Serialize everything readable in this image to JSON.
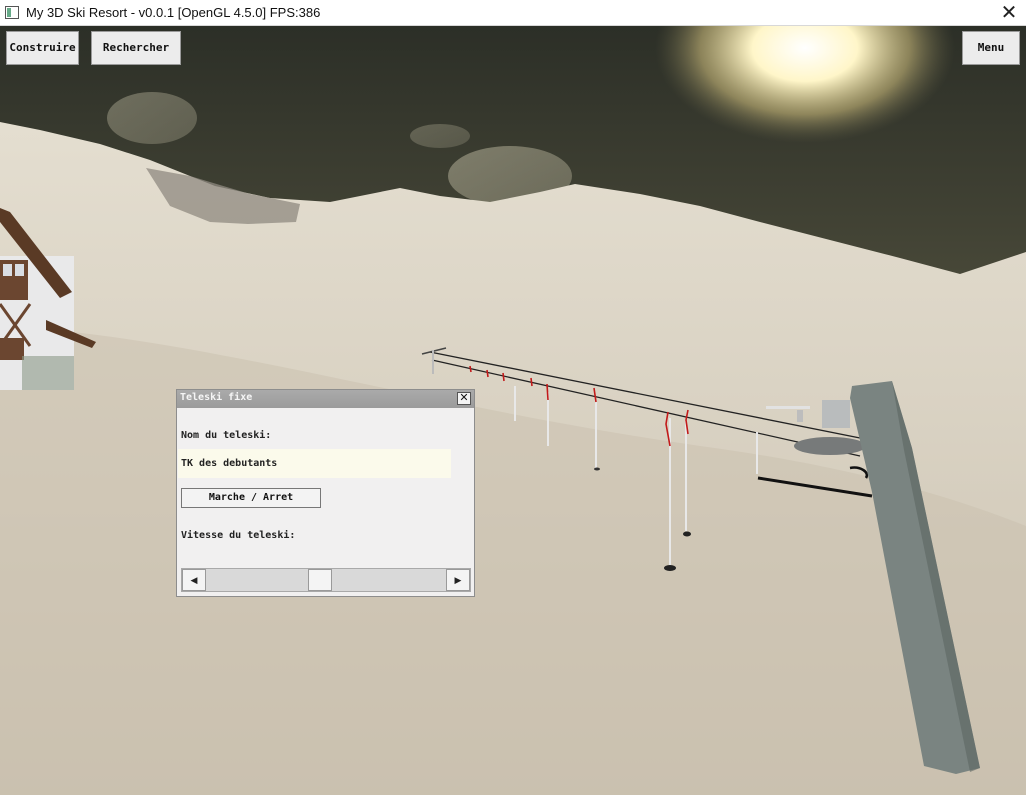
{
  "window": {
    "title": "My 3D Ski Resort - v0.0.1 [OpenGL 4.5.0] FPS:386",
    "close_glyph": "✕"
  },
  "toolbar": {
    "build_label": "Construire",
    "search_label": "Rechercher",
    "menu_label": "Menu"
  },
  "dialog": {
    "title": "Teleski fixe",
    "close_glyph": "✕",
    "name_label": "Nom du teleski:",
    "name_value": "TK des debutants",
    "toggle_label": "Marche / Arret",
    "speed_label": "Vitesse du teleski:",
    "speed_left_glyph": "◀",
    "speed_right_glyph": "▶",
    "speed_level": 0.47
  },
  "colors": {
    "sky": "#33362c",
    "snow": "#d3cbbb",
    "lift_marker": "#c21a1a",
    "dialog_bg": "#f1f0f0",
    "input_bg": "#fbfaeb"
  }
}
